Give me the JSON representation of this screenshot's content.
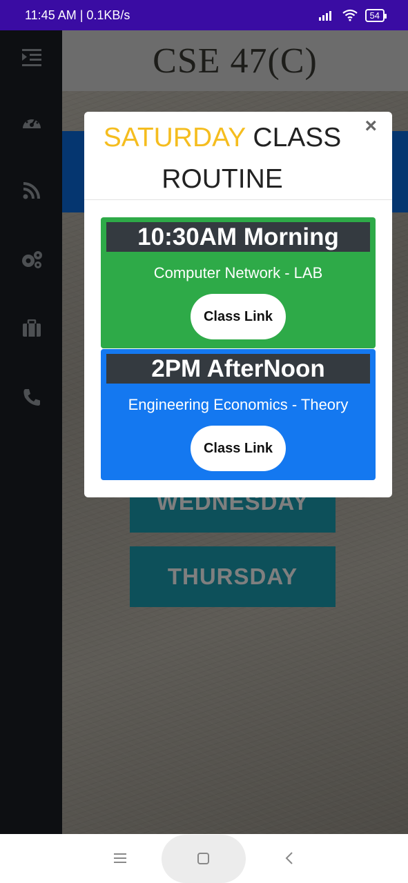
{
  "status_bar": {
    "time": "11:45 AM | 0.1KB/s",
    "battery": "54"
  },
  "sidebar": {
    "items": [
      "menu-icon",
      "dashboard-icon",
      "rss-icon",
      "settings-icon",
      "briefcase-icon",
      "phone-icon"
    ]
  },
  "header": {
    "title": "CSE 47(C)"
  },
  "background": {
    "days": [
      "WEDNESDAY",
      "THURSDAY"
    ]
  },
  "modal": {
    "title_highlight": "SATURDAY",
    "title_rest": "CLASS ROUTINE",
    "close": "×",
    "classes": [
      {
        "time": "10:30AM Morning",
        "subject": "Computer Network - LAB",
        "link_label": "Class Link",
        "color": "#2eaa48"
      },
      {
        "time": "2PM AfterNoon",
        "subject": "Engineering Economics - Theory",
        "link_label": "Class Link",
        "color": "#1478f0"
      }
    ]
  },
  "colors": {
    "status_bar": "#3a0ca3",
    "sidebar": "#1b1f24",
    "highlight": "#f5bd1f",
    "day_button": "#1aa1b4"
  }
}
